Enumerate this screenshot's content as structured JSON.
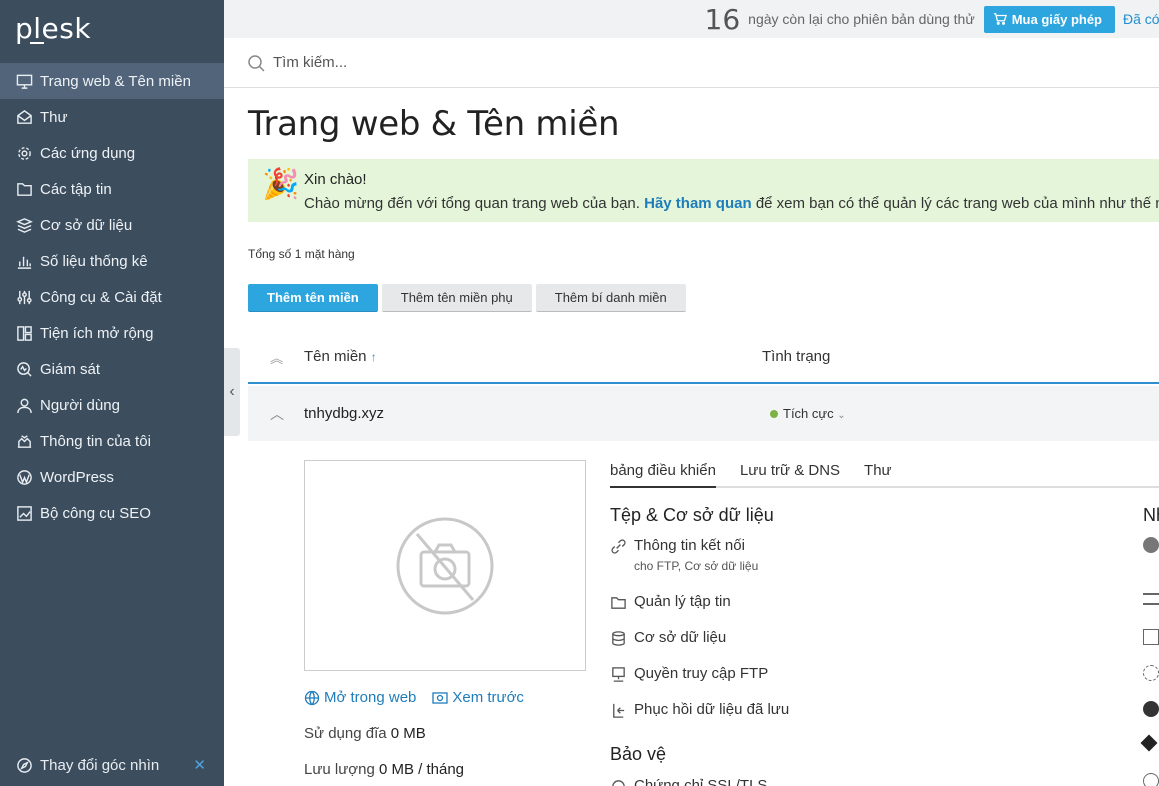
{
  "app": {
    "logo": "plesk"
  },
  "sidebar": {
    "items": [
      {
        "label": "Trang web & Tên miền",
        "icon": "monitor-icon"
      },
      {
        "label": "Thư",
        "icon": "mail-icon"
      },
      {
        "label": "Các ứng dụng",
        "icon": "gear-icon"
      },
      {
        "label": "Các tập tin",
        "icon": "folder-icon"
      },
      {
        "label": "Cơ sở dữ liệu",
        "icon": "database-icon"
      },
      {
        "label": "Số liệu thống kê",
        "icon": "stats-icon"
      },
      {
        "label": "Công cụ & Cài đặt",
        "icon": "tools-icon"
      },
      {
        "label": "Tiện ích mở rộng",
        "icon": "extensions-icon"
      },
      {
        "label": "Giám sát",
        "icon": "monitoring-icon"
      },
      {
        "label": "Người dùng",
        "icon": "user-icon"
      },
      {
        "label": "Thông tin của tôi",
        "icon": "profile-icon"
      },
      {
        "label": "WordPress",
        "icon": "wordpress-icon"
      },
      {
        "label": "Bộ công cụ SEO",
        "icon": "seo-icon"
      }
    ],
    "view_switch": "Thay đổi góc nhìn"
  },
  "topbar": {
    "days": "16",
    "trial_text": "ngày còn lại cho phiên bản dùng thử",
    "buy_label": "Mua giấy phép",
    "already": "Đã có"
  },
  "search": {
    "placeholder": "Tìm kiếm..."
  },
  "page": {
    "title": "Trang web & Tên miền"
  },
  "welcome": {
    "hello": "Xin chào!",
    "msg_before": "Chào mừng đến với tổng quan trang web của bạn.",
    "link": "Hãy tham quan",
    "msg_after": "để xem bạn có thể quản lý các trang web của mình như thế nào."
  },
  "list": {
    "total": "Tổng số 1 mặt hàng",
    "buttons": {
      "add_domain": "Thêm tên miền",
      "add_subdomain": "Thêm tên miền phụ",
      "add_alias": "Thêm bí danh miền"
    },
    "columns": {
      "domain": "Tên miền",
      "status": "Tình trạng"
    },
    "rows": [
      {
        "domain": "tnhydbg.xyz",
        "status": "Tích cực"
      }
    ]
  },
  "site": {
    "open_web": "Mở trong web",
    "preview": "Xem trước",
    "disk_label": "Sử dụng đĩa",
    "disk_value": "0 MB",
    "traffic_label": "Lưu lượng",
    "traffic_value": "0 MB / tháng",
    "tabs": [
      "bảng điều khiển",
      "Lưu trữ & DNS",
      "Thư"
    ],
    "section_files": "Tệp & Cơ sở dữ liệu",
    "items": {
      "connection": "Thông tin kết nối",
      "connection_sub": "cho FTP, Cơ sở dữ liệu",
      "file_manager": "Quản lý tập tin",
      "databases": "Cơ sở dữ liệu",
      "ftp": "Quyền truy cập FTP",
      "backup": "Phục hồi dữ liệu đã lưu"
    },
    "section_security": "Bảo vệ",
    "ssl": "Chứng chỉ SSL/TLS",
    "right_heading_partial": "Nh"
  }
}
